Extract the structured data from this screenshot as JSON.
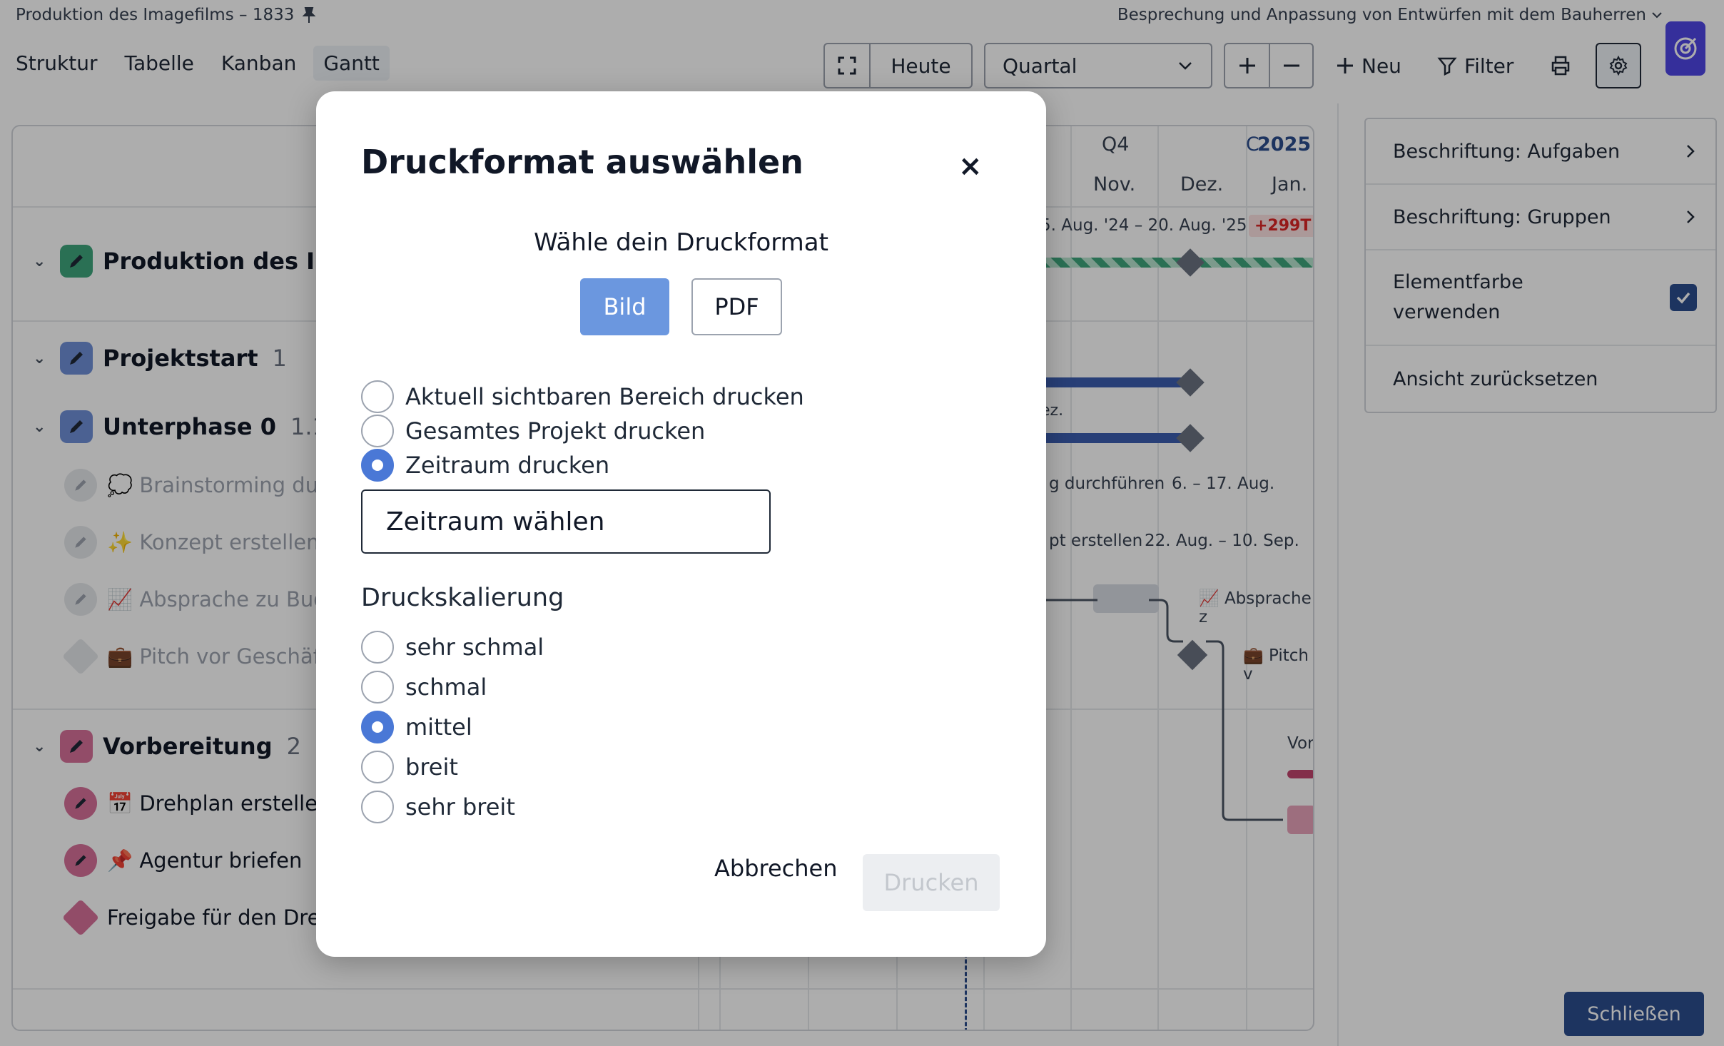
{
  "header": {
    "project_title": "Produktion des Imagefilms – 1833",
    "meeting": "Besprechung und Anpassung von Entwürfen mit dem Bauherren",
    "tabs": [
      "Struktur",
      "Tabelle",
      "Kanban",
      "Gantt"
    ],
    "active_tab": "Gantt",
    "today": "Heute",
    "zoom_select": "Quartal",
    "new_label": "Neu",
    "filter_label": "Filter"
  },
  "gantt": {
    "quarter": "Q4",
    "year": "2025",
    "year_prefix": "C",
    "months": [
      "Nov.",
      "Dez.",
      "Jan."
    ],
    "date_range": "5. Aug. '24 – 20. Aug. '25",
    "overdue_badge": "+299T",
    "rows": [
      {
        "label": "Produktion des Ima",
        "num": ""
      },
      {
        "label": "Projektstart",
        "num": "1"
      },
      {
        "label": "Unterphase 0",
        "num": "1.1"
      },
      {
        "label": "💭 Brainstorming durch",
        "num": ""
      },
      {
        "label": "✨ Konzept erstellen",
        "num": ""
      },
      {
        "label": "📈 Absprache zu Budg",
        "num": ""
      },
      {
        "label": "💼 Pitch vor Geschäfts",
        "num": ""
      },
      {
        "label": "Vorbereitung",
        "num": "2"
      },
      {
        "label": "📅 Drehplan erstellen",
        "num": ""
      },
      {
        "label": "📌 Agentur briefen",
        "num": ""
      },
      {
        "label": "Freigabe für den Dreh",
        "num": ""
      }
    ],
    "bar_labels": {
      "dez": "ez.",
      "brainstorm": "g durchführen",
      "brainstorm_date": "6. – 17. Aug.",
      "konzept": "pt erstellen",
      "konzept_date": "22. Aug. – 10. Sep.",
      "absprache": "📈 Absprache z",
      "pitch": "💼 Pitch v",
      "vor": "Vor"
    }
  },
  "right_panel": {
    "items": [
      {
        "label": "Beschriftung: Aufgaben"
      },
      {
        "label": "Beschriftung: Gruppen"
      },
      {
        "label": "Elementfarbe verwenden",
        "checked": true
      },
      {
        "label": "Ansicht zurücksetzen"
      }
    ],
    "close_label": "Schließen"
  },
  "modal": {
    "title": "Druckformat auswählen",
    "subtitle": "Wähle dein Druckformat",
    "format_image": "Bild",
    "format_pdf": "PDF",
    "selected_format": "Bild",
    "range_options": [
      {
        "label": "Aktuell sichtbaren Bereich drucken",
        "selected": false
      },
      {
        "label": "Gesamtes Projekt drucken",
        "selected": false
      },
      {
        "label": "Zeitraum drucken",
        "selected": true
      }
    ],
    "date_range_value": "Zeitraum wählen",
    "scaling_title": "Druckskalierung",
    "scaling_options": [
      {
        "label": "sehr schmal",
        "selected": false
      },
      {
        "label": "schmal",
        "selected": false
      },
      {
        "label": "mittel",
        "selected": true
      },
      {
        "label": "breit",
        "selected": false
      },
      {
        "label": "sehr breit",
        "selected": false
      }
    ],
    "cancel_label": "Abbrechen",
    "print_label": "Drucken"
  },
  "colors": {
    "primary": "#6b97df",
    "radio_selected": "#4a78d6",
    "navy": "#2b4d8e",
    "green_group": "#3fa57d",
    "blue_group": "#3b5eb0",
    "pink_group": "#c2446e",
    "overdue_red": "#dc2626"
  }
}
